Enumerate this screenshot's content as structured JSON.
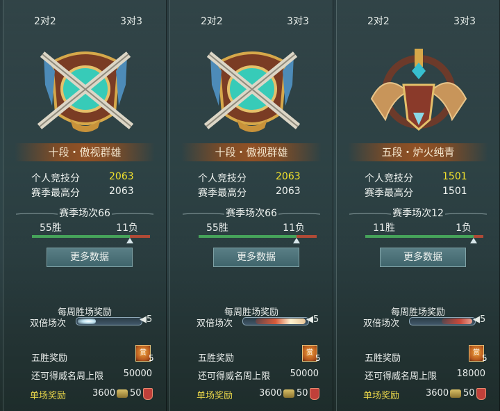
{
  "panels": [
    {
      "tabs": [
        "2对2",
        "3对3"
      ],
      "rank_title": "十段・傲视群雄",
      "stats": [
        {
          "label": "个人竞技分",
          "value": "2063"
        },
        {
          "label": "赛季最高分",
          "value": "2063"
        }
      ],
      "season_matches": "赛季场次66",
      "wins": "55胜",
      "losses": "11负",
      "win_fraction": 0.83,
      "more_button": "更多数据",
      "weekly_title": "每周胜场奖励",
      "double_label": "双倍场次",
      "double_count": "5",
      "five_win_label": "五胜奖励",
      "five_win_count": "5",
      "cap_label": "还可得威名周上限",
      "cap_value": "50000",
      "single_label": "单场奖励",
      "single_value1": "3600",
      "single_value2": "50",
      "emblem": "gold-swords-emblem-icon"
    },
    {
      "tabs": [
        "2对2",
        "3对3"
      ],
      "rank_title": "十段・傲视群雄",
      "stats": [
        {
          "label": "个人竞技分",
          "value": "2063"
        },
        {
          "label": "赛季最高分",
          "value": "2063"
        }
      ],
      "season_matches": "赛季场次66",
      "wins": "55胜",
      "losses": "11负",
      "win_fraction": 0.83,
      "more_button": "更多数据",
      "weekly_title": "每周胜场奖励",
      "double_label": "双倍场次",
      "double_count": "5",
      "five_win_label": "五胜奖励",
      "five_win_count": "5",
      "cap_label": "还可得威名周上限",
      "cap_value": "50000",
      "single_label": "单场奖励",
      "single_value1": "3600",
      "single_value2": "50",
      "emblem": "gold-swords-emblem-icon"
    },
    {
      "tabs": [
        "2对2",
        "3对3"
      ],
      "rank_title": "五段・炉火纯青",
      "stats": [
        {
          "label": "个人竞技分",
          "value": "1501"
        },
        {
          "label": "赛季最高分",
          "value": "1501"
        }
      ],
      "season_matches": "赛季场次12",
      "wins": "11胜",
      "losses": "1负",
      "win_fraction": 0.92,
      "more_button": "更多数据",
      "weekly_title": "每周胜场奖励",
      "double_label": "双倍场次",
      "double_count": "5",
      "five_win_label": "五胜奖励",
      "five_win_count": "5",
      "cap_label": "还可得威名周上限",
      "cap_value": "18000",
      "single_label": "单场奖励",
      "single_value1": "3600",
      "single_value2": "50",
      "emblem": "winged-sword-emblem-icon"
    }
  ],
  "colors": {
    "highlight": "#f2e22c",
    "win_bar": "#46a35a",
    "loss_bar": "#b04a36",
    "single_label": "#e9d64a"
  }
}
